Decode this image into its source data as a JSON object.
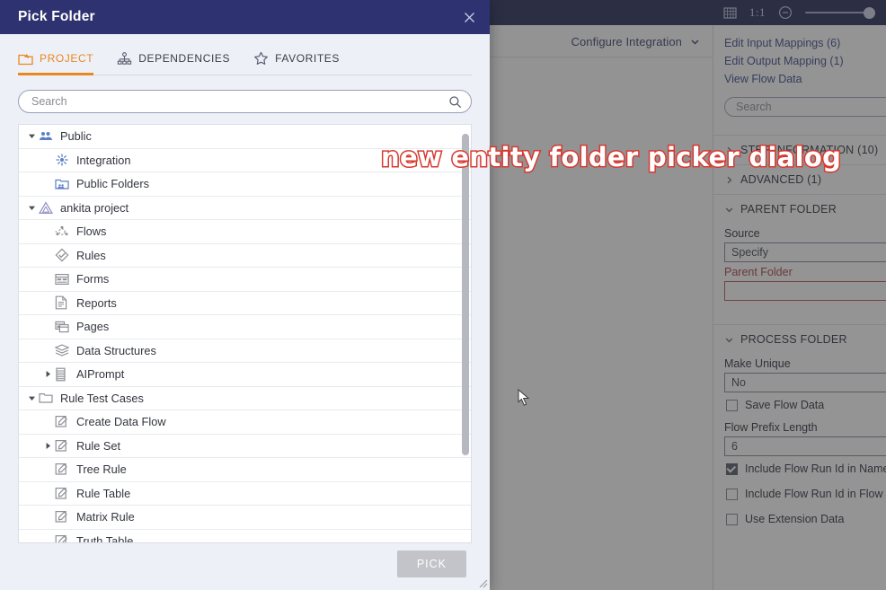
{
  "annotation": {
    "text": "new entity folder picker dialog"
  },
  "topbar": {
    "grid_icon": "grid-icon",
    "one_to_one_label": "1:1",
    "zoom_out_icon": "zoom-out-icon",
    "zoom_slider_icon": "zoom-slider"
  },
  "canvas": {
    "configure_label": "Configure Integration",
    "chevron_icon": "chevron-down-icon"
  },
  "properties": {
    "links": [
      "Edit Input Mappings (6)",
      "Edit Output Mapping (1)",
      "View Flow Data"
    ],
    "search_placeholder": "Search",
    "sections": [
      {
        "label": "STEP INFORMATION (10)",
        "expanded": false
      },
      {
        "label": "ADVANCED (1)",
        "expanded": false
      },
      {
        "label": "PARENT FOLDER",
        "expanded": true
      },
      {
        "label": "PROCESS FOLDER",
        "expanded": true
      }
    ],
    "parent_folder": {
      "source_label": "Source",
      "source_value": "Specify",
      "parent_folder_label": "Parent Folder",
      "parent_folder_value": ""
    },
    "process_folder": {
      "make_unique_label": "Make Unique",
      "make_unique_value": "No",
      "save_flow_data_label": "Save Flow Data",
      "save_flow_data_checked": false,
      "flow_prefix_label": "Flow Prefix Length",
      "flow_prefix_value": "6",
      "include_run_id_name_label": "Include Flow Run Id in Name",
      "include_run_id_name_checked": true,
      "include_run_id_flow_label": "Include Flow Run Id in Flow",
      "include_run_id_flow_checked": false,
      "use_extension_data_label": "Use Extension Data",
      "use_extension_data_checked": false
    }
  },
  "dialog": {
    "title": "Pick Folder",
    "close_icon": "close-icon",
    "tabs": [
      {
        "label": "PROJECT",
        "icon": "project-icon",
        "active": true
      },
      {
        "label": "DEPENDENCIES",
        "icon": "dependencies-icon",
        "active": false
      },
      {
        "label": "FAVORITES",
        "icon": "star-icon",
        "active": false
      }
    ],
    "search_placeholder": "Search",
    "search_icon": "search-icon",
    "pick_button": "PICK",
    "tree": [
      {
        "label": "Public",
        "indent": 0,
        "arrow": "down",
        "icon": "public-icon",
        "tint": "blue"
      },
      {
        "label": "Integration",
        "indent": 1,
        "arrow": "none",
        "icon": "integration-icon",
        "tint": "blue"
      },
      {
        "label": "Public Folders",
        "indent": 1,
        "arrow": "none",
        "icon": "public-folders-icon",
        "tint": "blue"
      },
      {
        "label": "ankita project",
        "indent": 0,
        "arrow": "down",
        "icon": "project-tree-icon",
        "tint": "violet"
      },
      {
        "label": "Flows",
        "indent": 1,
        "arrow": "none",
        "icon": "flows-icon",
        "tint": "grey"
      },
      {
        "label": "Rules",
        "indent": 1,
        "arrow": "none",
        "icon": "rules-icon",
        "tint": "grey"
      },
      {
        "label": "Forms",
        "indent": 1,
        "arrow": "none",
        "icon": "forms-icon",
        "tint": "grey"
      },
      {
        "label": "Reports",
        "indent": 1,
        "arrow": "none",
        "icon": "reports-icon",
        "tint": "grey"
      },
      {
        "label": "Pages",
        "indent": 1,
        "arrow": "none",
        "icon": "pages-icon",
        "tint": "grey"
      },
      {
        "label": "Data Structures",
        "indent": 1,
        "arrow": "none",
        "icon": "data-structures-icon",
        "tint": "grey"
      },
      {
        "label": "AIPrompt",
        "indent": 1,
        "arrow": "right",
        "icon": "aiprompt-icon",
        "tint": "grey"
      },
      {
        "label": "Rule Test Cases",
        "indent": 0,
        "arrow": "down",
        "icon": "folder-icon",
        "tint": "grey"
      },
      {
        "label": "Create Data Flow",
        "indent": 1,
        "arrow": "none",
        "icon": "rule-icon",
        "tint": "grey"
      },
      {
        "label": "Rule Set",
        "indent": 1,
        "arrow": "right",
        "icon": "rule-icon",
        "tint": "grey"
      },
      {
        "label": "Tree Rule",
        "indent": 1,
        "arrow": "none",
        "icon": "rule-icon",
        "tint": "grey"
      },
      {
        "label": "Rule Table",
        "indent": 1,
        "arrow": "none",
        "icon": "rule-icon",
        "tint": "grey"
      },
      {
        "label": "Matrix Rule",
        "indent": 1,
        "arrow": "none",
        "icon": "rule-icon",
        "tint": "grey"
      },
      {
        "label": "Truth Table",
        "indent": 1,
        "arrow": "none",
        "icon": "rule-icon",
        "tint": "grey"
      }
    ]
  },
  "colors": {
    "dialog_header": "#2e3270",
    "accent_orange": "#e8881f",
    "topbar_navy": "#1a1f4d",
    "required_red": "#a2352f",
    "annotation_outline": "#d7392f"
  }
}
